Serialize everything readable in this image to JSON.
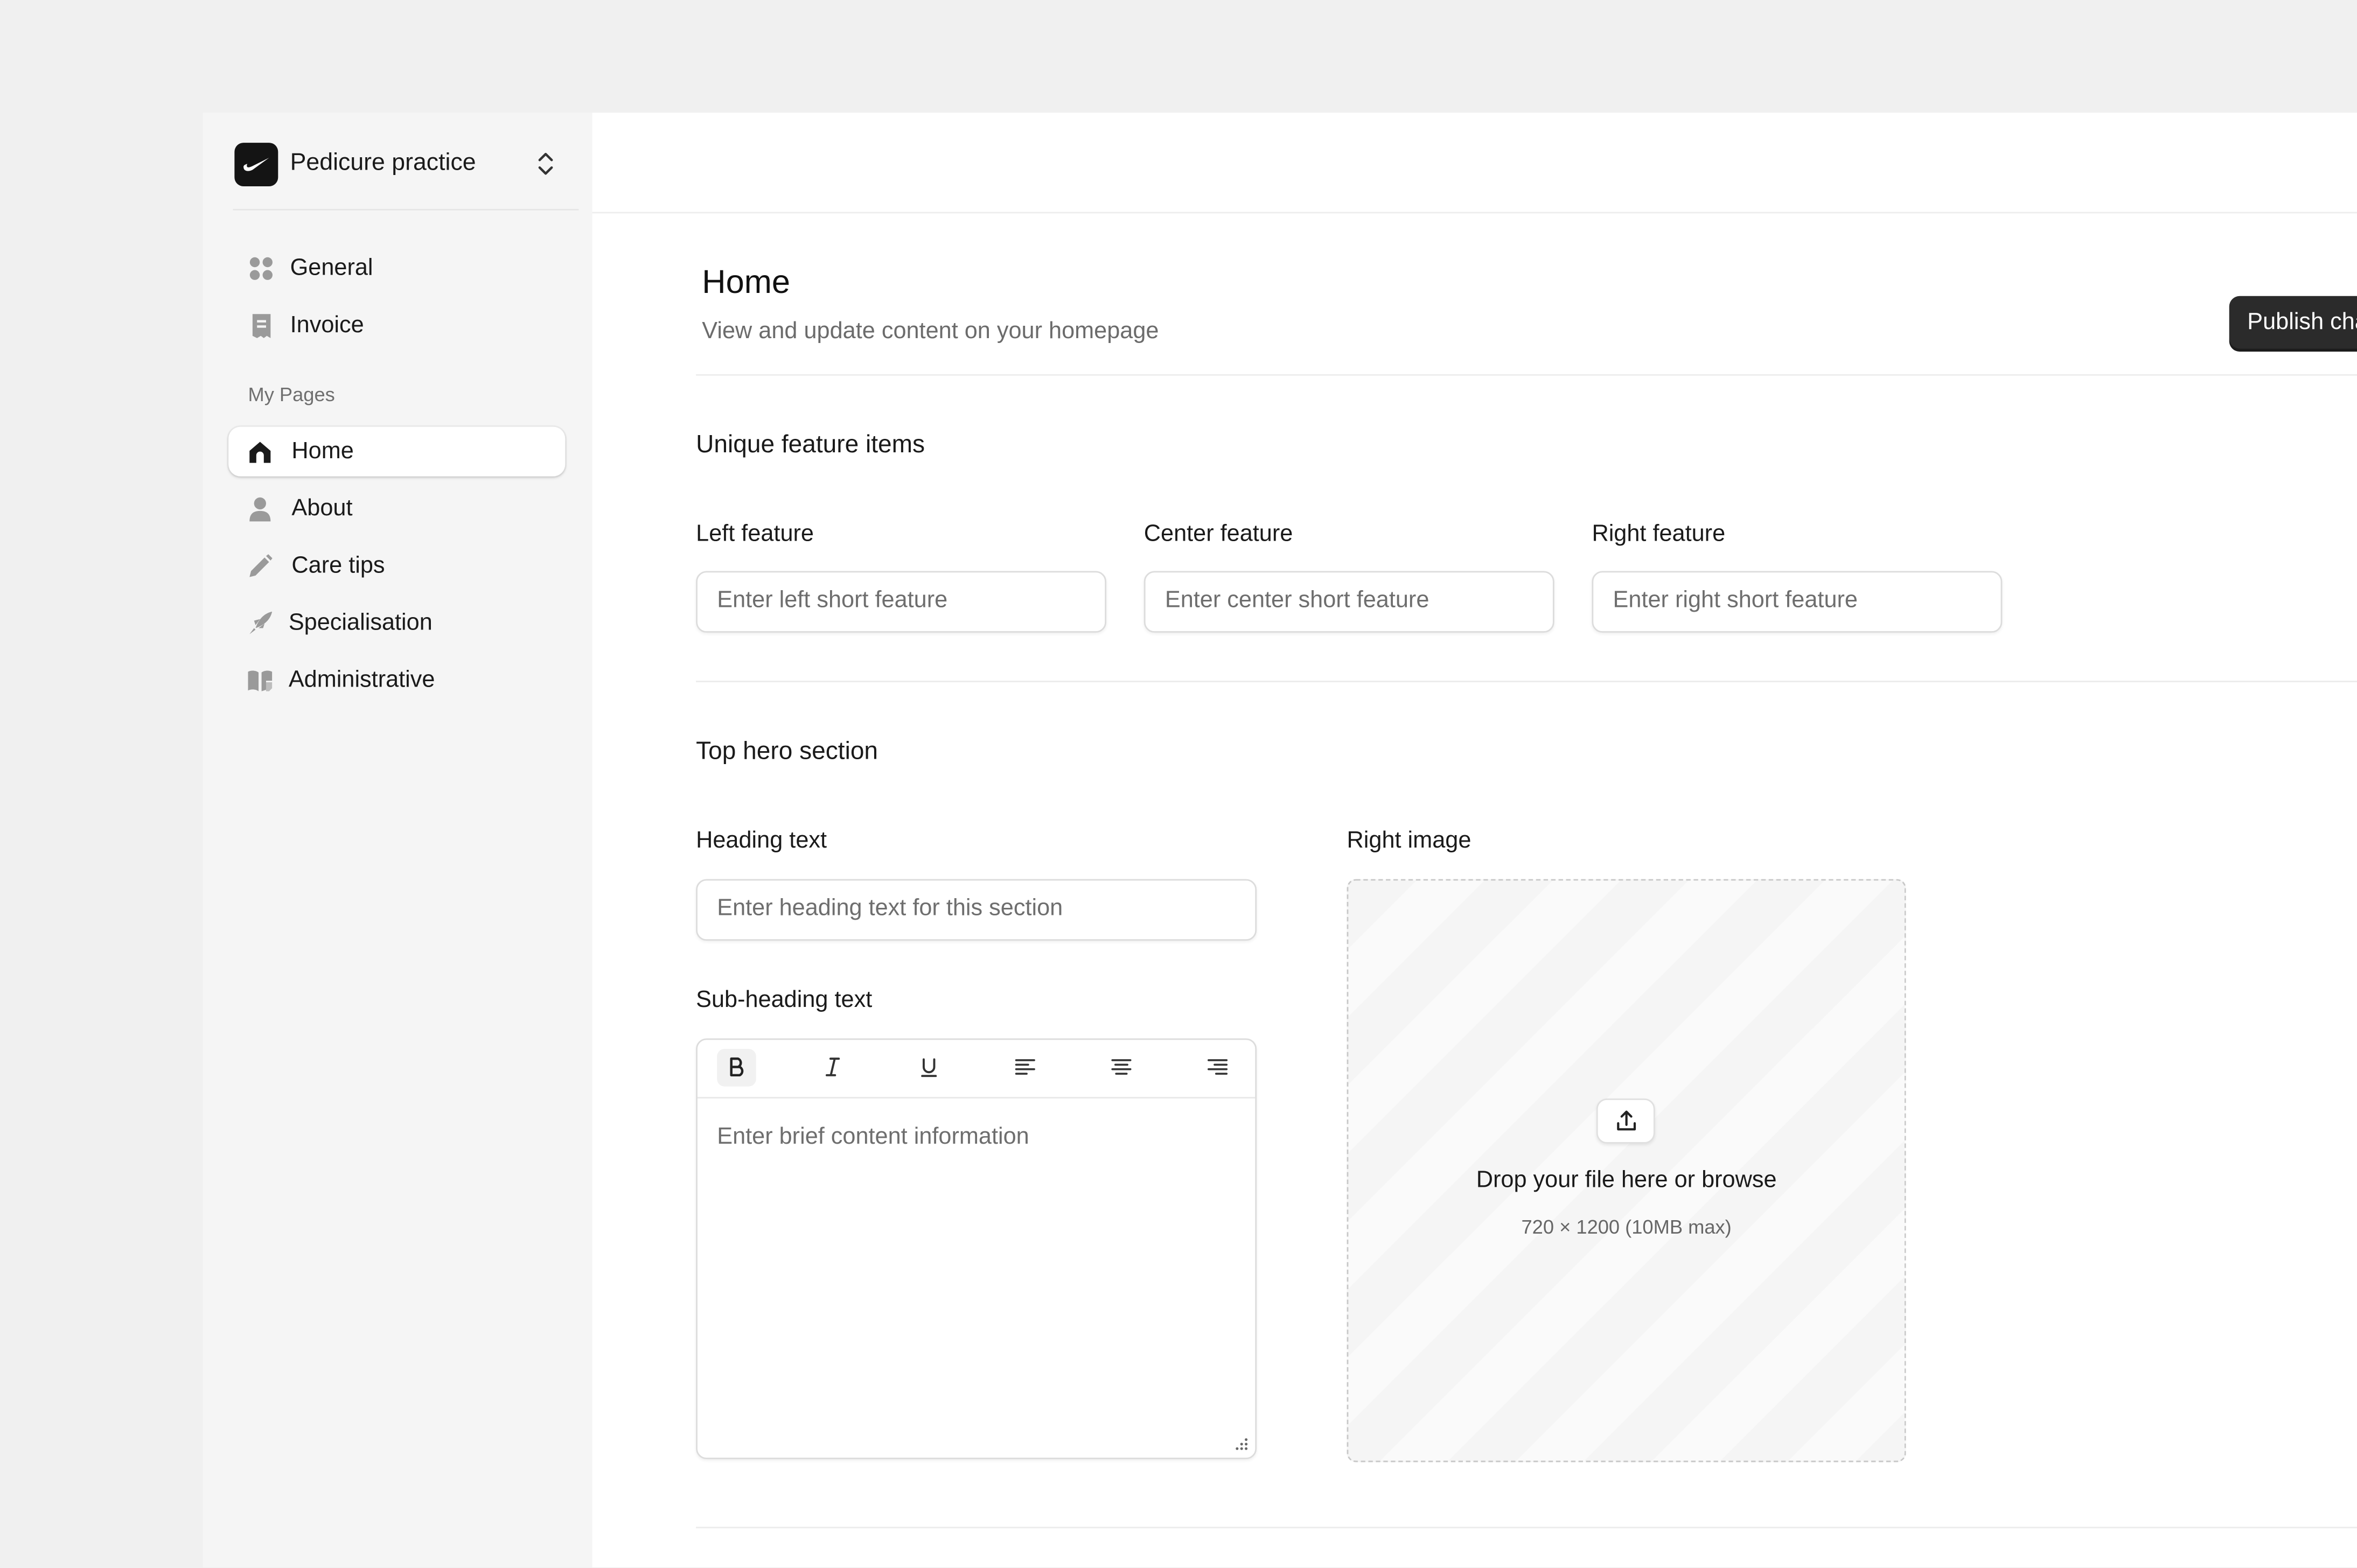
{
  "workspace": {
    "name": "Pedicure practice"
  },
  "sidebar": {
    "top_items": [
      {
        "label": "General",
        "icon": "grid-icon"
      },
      {
        "label": "Invoice",
        "icon": "receipt-icon"
      }
    ],
    "section_label": "My Pages",
    "page_items": [
      {
        "label": "Home",
        "icon": "home-icon",
        "active": true
      },
      {
        "label": "About",
        "icon": "user-icon"
      },
      {
        "label": "Care tips",
        "icon": "pencil-icon"
      },
      {
        "label": "Specialisation",
        "icon": "rocket-icon"
      },
      {
        "label": "Administrative",
        "icon": "book-icon"
      }
    ]
  },
  "page": {
    "title": "Home",
    "subtitle": "View and update content on your homepage",
    "publish_label": "Publish changes"
  },
  "features": {
    "heading": "Unique feature items",
    "left": {
      "label": "Left feature",
      "placeholder": "Enter left short feature"
    },
    "center": {
      "label": "Center feature",
      "placeholder": "Enter center short feature"
    },
    "right": {
      "label": "Right feature",
      "placeholder": "Enter right short feature"
    }
  },
  "hero": {
    "heading": "Top hero section",
    "heading_text": {
      "label": "Heading text",
      "placeholder": "Enter heading text for this section"
    },
    "subheading_text": {
      "label": "Sub-heading text",
      "placeholder": "Enter brief content information"
    },
    "toolbar": [
      "bold",
      "italic",
      "underline",
      "align-left",
      "align-center",
      "align-right"
    ],
    "right_image": {
      "label": "Right image",
      "drop_text": "Drop your file here or browse",
      "hint": "720 × 1200 (10MB max)"
    }
  },
  "colors": {
    "accent": "#2b2b2b",
    "sidebar_bg": "#f5f5f5",
    "page_bg": "#f0f0f0"
  }
}
